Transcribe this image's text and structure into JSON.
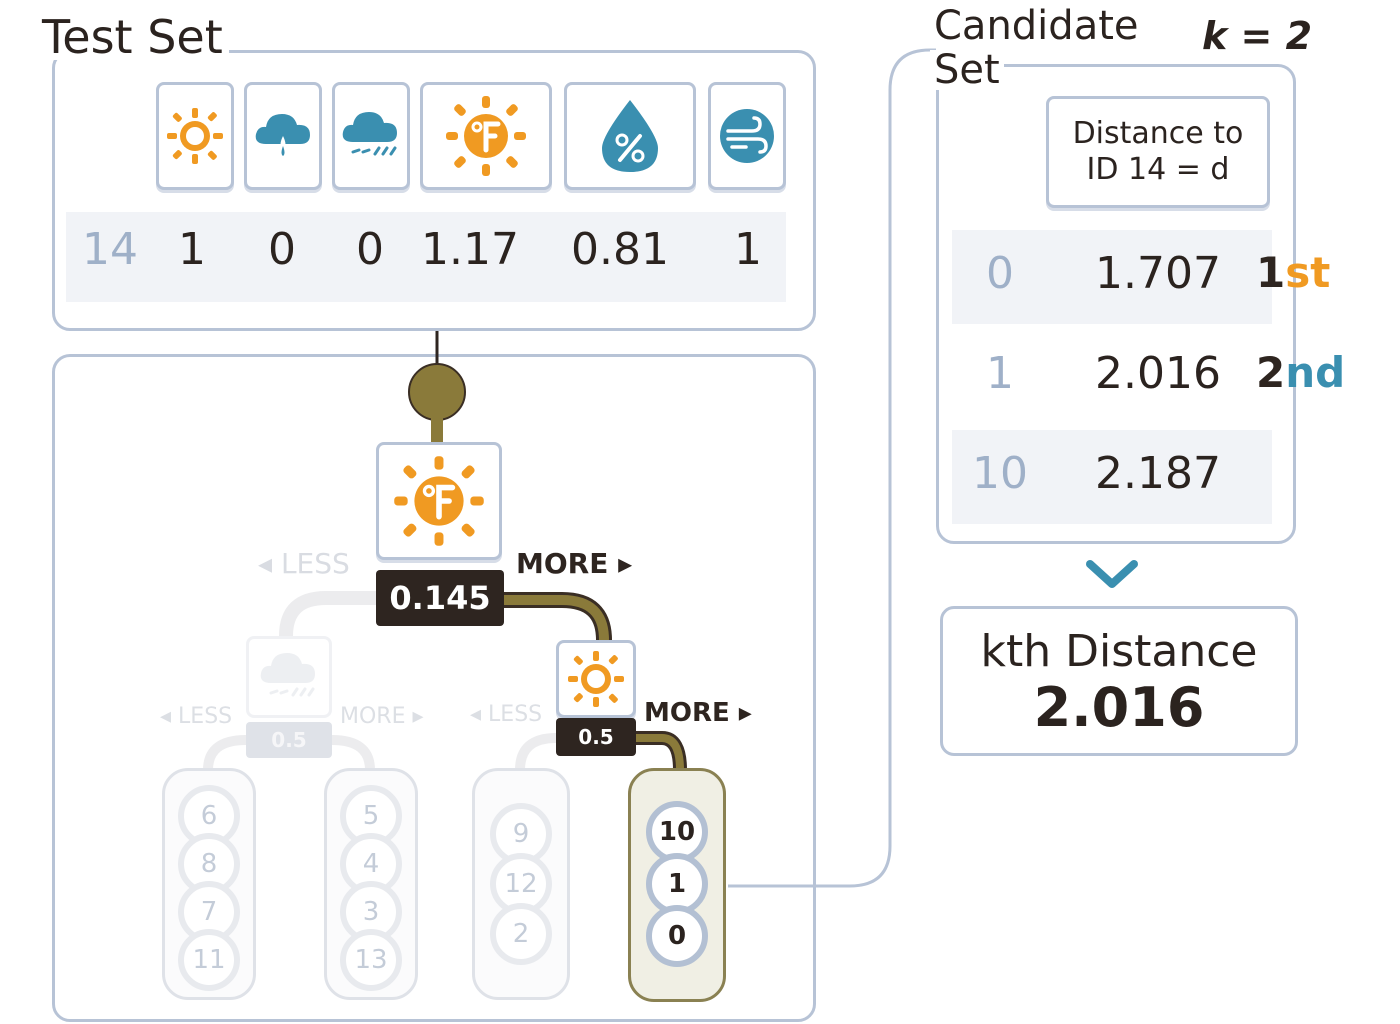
{
  "test_set": {
    "title": "Test Set",
    "id": "14",
    "values": [
      "1",
      "0",
      "0",
      "1.17",
      "0.81",
      "1"
    ],
    "feature_icons": [
      "sun-icon",
      "rain-cloud-icon",
      "snow-cloud-icon",
      "temperature-sun-icon",
      "humidity-drop-icon",
      "wind-icon"
    ]
  },
  "tree": {
    "root": {
      "icon": "temperature-sun-icon",
      "threshold": "0.145",
      "less_label": "◂ LESS",
      "more_label": "MORE ▸"
    },
    "left_node": {
      "icon": "snow-cloud-icon",
      "threshold": "0.5",
      "less_label": "◂ LESS",
      "more_label": "MORE ▸"
    },
    "right_node": {
      "icon": "sun-icon",
      "threshold": "0.5",
      "less_label": "◂ LESS",
      "more_label": "MORE ▸"
    },
    "leaves": [
      {
        "ids": [
          "6",
          "8",
          "7",
          "11"
        ]
      },
      {
        "ids": [
          "5",
          "4",
          "3",
          "13"
        ]
      },
      {
        "ids": [
          "9",
          "12",
          "2"
        ]
      },
      {
        "ids": [
          "10",
          "1",
          "0"
        ]
      }
    ]
  },
  "candidate_set": {
    "title_line1": "Candidate",
    "title_line2": "Set",
    "k_label": "k = 2",
    "header_line1": "Distance to",
    "header_line2": "ID 14 = d",
    "rows": [
      {
        "id": "0",
        "distance": "1.707",
        "rank_num": "1",
        "rank_suffix": "st"
      },
      {
        "id": "1",
        "distance": "2.016",
        "rank_num": "2",
        "rank_suffix": "nd"
      },
      {
        "id": "10",
        "distance": "2.187",
        "rank_num": "",
        "rank_suffix": ""
      }
    ]
  },
  "result": {
    "label": "kth Distance",
    "value": "2.016"
  },
  "colors": {
    "orange": "#f09a22",
    "blue": "#3a8fb0",
    "dark": "#2e2520",
    "border": "#b7c3d6",
    "olive": "#8a7a3a"
  }
}
